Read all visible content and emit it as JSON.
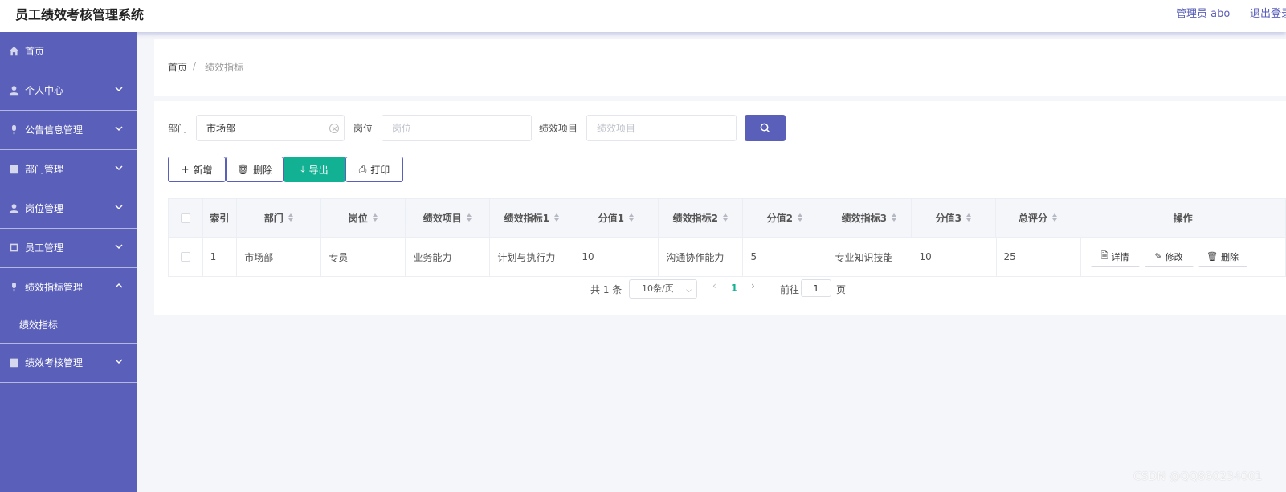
{
  "header": {
    "title": "员工绩效考核管理系统",
    "user": "管理员 abo",
    "logout": "退出登录"
  },
  "sidebar": {
    "items": [
      {
        "label": "首页",
        "icon": "home-icon",
        "has_arrow": false
      },
      {
        "label": "个人中心",
        "icon": "user-icon",
        "has_arrow": true
      },
      {
        "label": "公告信息管理",
        "icon": "mic-icon",
        "has_arrow": true
      },
      {
        "label": "部门管理",
        "icon": "clipboard-icon",
        "has_arrow": true
      },
      {
        "label": "岗位管理",
        "icon": "user-icon",
        "has_arrow": true
      },
      {
        "label": "员工管理",
        "icon": "square-icon",
        "has_arrow": true
      },
      {
        "label": "绩效指标管理",
        "icon": "mic-icon",
        "has_arrow": true,
        "expanded": true
      },
      {
        "label": "绩效考核管理",
        "icon": "clipboard-icon",
        "has_arrow": true
      }
    ],
    "sub_item": "绩效指标"
  },
  "breadcrumb": {
    "home": "首页",
    "separator": "/",
    "current": "绩效指标"
  },
  "filters": {
    "dept_label": "部门",
    "dept_value": "市场部",
    "post_label": "岗位",
    "post_placeholder": "岗位",
    "item_label": "绩效项目",
    "item_placeholder": "绩效项目"
  },
  "actions": {
    "add": "新增",
    "delete": "删除",
    "export": "导出",
    "print": "打印"
  },
  "table": {
    "headers": [
      "索引",
      "部门",
      "岗位",
      "绩效项目",
      "绩效指标1",
      "分值1",
      "绩效指标2",
      "分值2",
      "绩效指标3",
      "分值3",
      "总评分",
      "操作"
    ],
    "rows": [
      [
        "1",
        "市场部",
        "专员",
        "业务能力",
        "计划与执行力",
        "10",
        "沟通协作能力",
        "5",
        "专业知识技能",
        "10",
        "25"
      ]
    ],
    "ops": {
      "detail": "详情",
      "edit": "修改",
      "delete": "删除"
    }
  },
  "pagination": {
    "total": "共 1 条",
    "page_size": "10条/页",
    "current_page": "1",
    "goto_label": "前往",
    "goto_value": "1",
    "page_unit": "页"
  },
  "watermark": "CSDN @QQ860234001",
  "colors": {
    "accent": "#5a5fb9",
    "export": "#13b193",
    "background": "#f5f6fa"
  }
}
